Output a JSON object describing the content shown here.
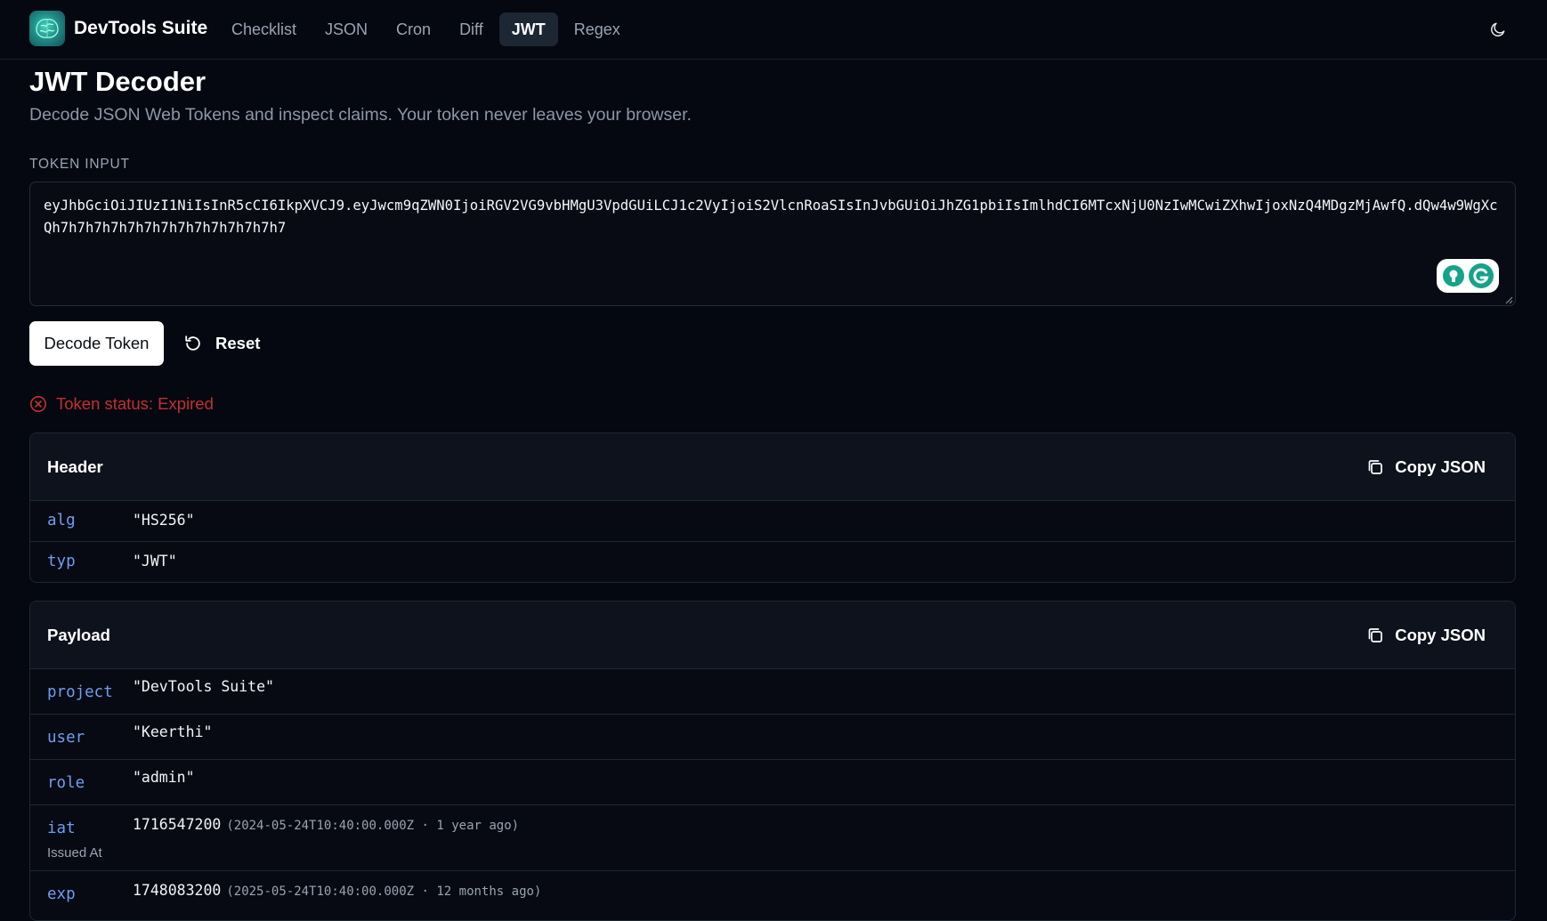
{
  "app": {
    "brand": "DevTools Suite",
    "nav": [
      {
        "label": "Checklist"
      },
      {
        "label": "JSON"
      },
      {
        "label": "Cron"
      },
      {
        "label": "Diff"
      },
      {
        "label": "JWT"
      },
      {
        "label": "Regex"
      }
    ],
    "active_tab": "JWT",
    "theme_icon": "moon-icon"
  },
  "page": {
    "title": "JWT Decoder",
    "subtitle": "Decode JSON Web Tokens and inspect claims. Your token never leaves your browser."
  },
  "token_input": {
    "label": "TOKEN INPUT",
    "value": "eyJhbGciOiJIUzI1NiIsInR5cCI6IkpXVCJ9.eyJwcm9qZWN0IjoiRGV2VG9vbHMgU3VpdGUiLCJ1c2VyIjoiS2VlcnRoaSIsInJvbGUiOiJhZG1pbiIsImlhdCI6MTcxNjU0NzIwMCwiZXhwIjoxNzQ4MDgzMjAwfQ.dQw4w9WgXcQh7h7h7h7h7h7h7h7h7h7h7h7h7h7"
  },
  "actions": {
    "decode_label": "Decode Token",
    "reset_label": "Reset"
  },
  "status": {
    "text": "Token status: Expired",
    "color": "#c42f33"
  },
  "header_card": {
    "title": "Header",
    "copy_label": "Copy JSON",
    "rows": [
      {
        "key": "alg",
        "value": "\"HS256\""
      },
      {
        "key": "typ",
        "value": "\"JWT\""
      }
    ]
  },
  "payload_card": {
    "title": "Payload",
    "copy_label": "Copy JSON",
    "rows": [
      {
        "key": "project",
        "value": "\"DevTools Suite\""
      },
      {
        "key": "user",
        "value": "\"Keerthi\""
      },
      {
        "key": "role",
        "value": "\"admin\""
      },
      {
        "key": "iat",
        "value": "1716547200",
        "note": "(2024-05-24T10:40:00.000Z · 1 year ago)",
        "sublabel": "Issued At"
      },
      {
        "key": "exp",
        "value": "1748083200",
        "note": "(2025-05-24T10:40:00.000Z · 12 months ago)"
      }
    ]
  },
  "colors": {
    "background": "#050810",
    "key_color": "#6f9df0",
    "accent_white": "#ffffff"
  }
}
